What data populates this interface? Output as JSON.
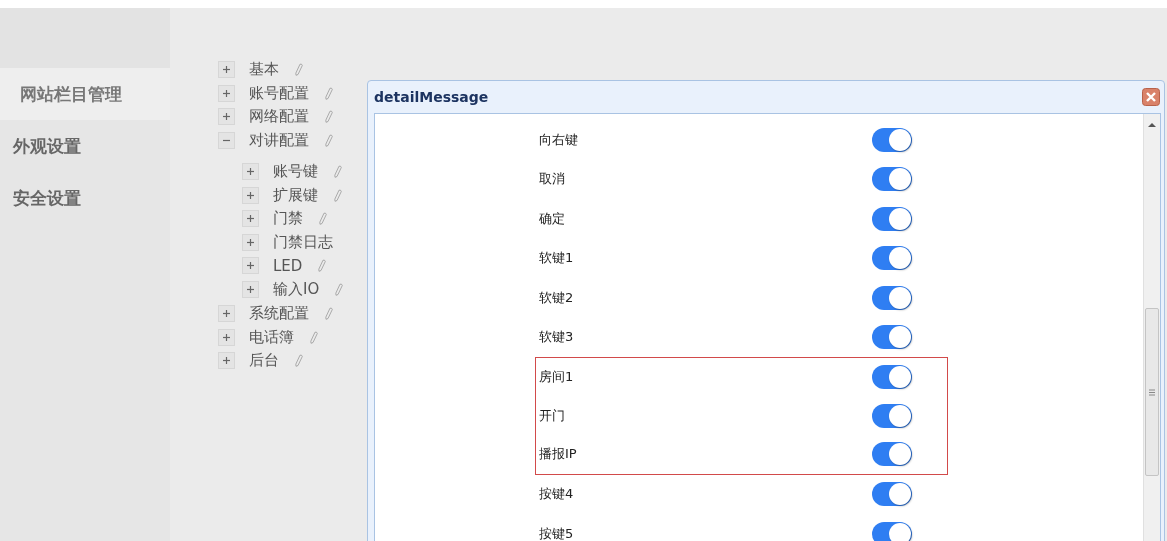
{
  "sidebar": {
    "items": [
      {
        "label": "网站栏目管理",
        "selected": true
      },
      {
        "label": "外观设置",
        "selected": false
      },
      {
        "label": "安全设置",
        "selected": false
      }
    ]
  },
  "tree": [
    {
      "label": "基本",
      "expanded": false,
      "editable": true
    },
    {
      "label": "账号配置",
      "expanded": false,
      "editable": true
    },
    {
      "label": "网络配置",
      "expanded": false,
      "editable": true
    },
    {
      "label": "对讲配置",
      "expanded": true,
      "editable": true,
      "children": [
        {
          "label": "账号键",
          "expanded": false,
          "editable": true
        },
        {
          "label": "扩展键",
          "expanded": false,
          "editable": true
        },
        {
          "label": "门禁",
          "expanded": false,
          "editable": true
        },
        {
          "label": "门禁日志",
          "expanded": false,
          "editable": false
        },
        {
          "label": "LED",
          "expanded": false,
          "editable": true
        },
        {
          "label": "输入IO",
          "expanded": false,
          "editable": true
        }
      ]
    },
    {
      "label": "系统配置",
      "expanded": false,
      "editable": true
    },
    {
      "label": "电话簿",
      "expanded": false,
      "editable": true
    },
    {
      "label": "后台",
      "expanded": false,
      "editable": true
    }
  ],
  "dialog": {
    "title": "detailMessage",
    "settings": [
      {
        "kind": "row",
        "label": "向右键",
        "on": true
      },
      {
        "kind": "row",
        "label": "取消",
        "on": true
      },
      {
        "kind": "row",
        "label": "确定",
        "on": true
      },
      {
        "kind": "row",
        "label": "软键1",
        "on": true
      },
      {
        "kind": "row",
        "label": "软键2",
        "on": true
      },
      {
        "kind": "row",
        "label": "软键3",
        "on": true
      },
      {
        "kind": "highlight",
        "rows": [
          {
            "label": "房间1",
            "on": true
          },
          {
            "label": "开门",
            "on": true
          },
          {
            "label": "播报IP",
            "on": true
          }
        ]
      },
      {
        "kind": "row",
        "label": "按键4",
        "on": true
      },
      {
        "kind": "row",
        "label": "按键5",
        "on": true
      }
    ]
  }
}
